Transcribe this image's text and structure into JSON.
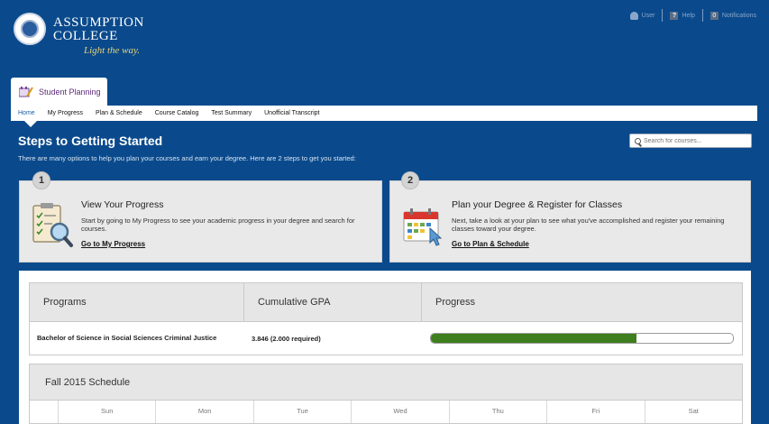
{
  "header": {
    "brand_line1": "ASSUMPTION",
    "brand_line2": "COLLEGE",
    "tagline": "Light the way.",
    "utility": {
      "user_label": "User",
      "help_label": "Help",
      "notifications_count": "0",
      "notifications_label": "Notifications"
    }
  },
  "app_tab": {
    "label": "Student Planning"
  },
  "nav": {
    "items": [
      {
        "label": "Home"
      },
      {
        "label": "My Progress"
      },
      {
        "label": "Plan & Schedule"
      },
      {
        "label": "Course Catalog"
      },
      {
        "label": "Test Summary"
      },
      {
        "label": "Unofficial Transcript"
      }
    ]
  },
  "page": {
    "title": "Steps to Getting Started",
    "subtitle": "There are many options to help you plan your courses and earn your degree. Here are 2 steps to get you started:",
    "search_placeholder": "Search for courses..."
  },
  "steps": [
    {
      "number": "1",
      "icon": "clipboard-magnifier-icon",
      "title": "View Your Progress",
      "text": "Start by going to My Progress to see your academic progress in your degree and search for courses.",
      "link": "Go to My Progress"
    },
    {
      "number": "2",
      "icon": "calendar-cursor-icon",
      "title": "Plan your Degree & Register for Classes",
      "text": "Next, take a look at your plan to see what you've accomplished and register your remaining classes toward your degree.",
      "link": "Go to Plan & Schedule"
    }
  ],
  "programs": {
    "headers": [
      "Programs",
      "Cumulative GPA",
      "Progress"
    ],
    "rows": [
      {
        "program": "Bachelor of Science in Social Sciences Criminal Justice",
        "gpa": "3.846 (2.000 required)",
        "progress_fraction": 0.68
      }
    ]
  },
  "schedule": {
    "title": "Fall 2015 Schedule",
    "days": [
      "Sun",
      "Mon",
      "Tue",
      "Wed",
      "Thu",
      "Fri",
      "Sat"
    ]
  },
  "colors": {
    "header_bg": "#0a4a8c",
    "progress_fill": "#3e7e1e",
    "tab_text": "#5c2a7a",
    "tagline": "#e7d37a"
  }
}
